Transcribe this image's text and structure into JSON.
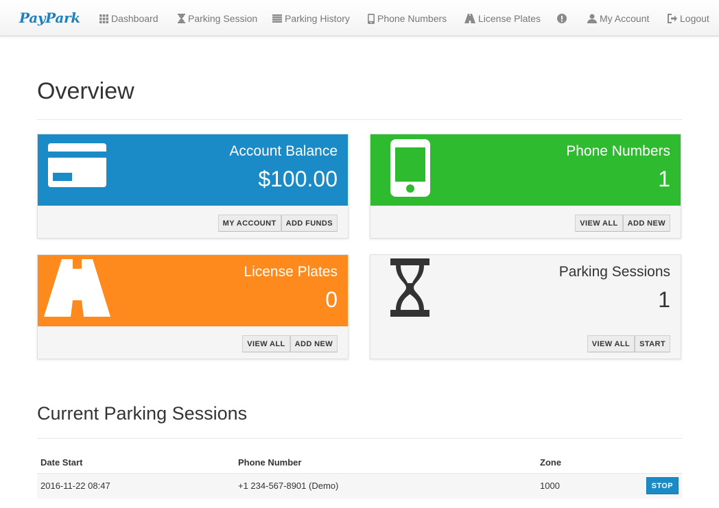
{
  "nav": {
    "brand": "PayPark",
    "items": [
      {
        "label": "Dashboard",
        "icon": "grid-icon"
      },
      {
        "label": "Parking Session",
        "icon": "hourglass-icon"
      },
      {
        "label": "Parking History",
        "icon": "list-icon"
      },
      {
        "label": "Phone Numbers",
        "icon": "phone-icon"
      },
      {
        "label": "License Plates",
        "icon": "road-icon"
      },
      {
        "label": "",
        "icon": "alert-icon"
      },
      {
        "label": "My Account",
        "icon": "user-icon"
      },
      {
        "label": "Logout",
        "icon": "logout-icon"
      }
    ]
  },
  "overview": {
    "title": "Overview",
    "cards": [
      {
        "title": "Account Balance",
        "value": "$100.00",
        "icon": "credit-card-icon",
        "color": "#1a8bc7",
        "buttons": [
          "MY ACCOUNT",
          "ADD FUNDS"
        ]
      },
      {
        "title": "Phone Numbers",
        "value": "1",
        "icon": "phone-icon",
        "color": "#2fbb2f",
        "buttons": [
          "VIEW ALL",
          "ADD NEW"
        ]
      },
      {
        "title": "License Plates",
        "value": "0",
        "icon": "road-icon",
        "color": "#fe8a1d",
        "buttons": [
          "VIEW ALL",
          "ADD NEW"
        ]
      },
      {
        "title": "Parking Sessions",
        "value": "1",
        "icon": "hourglass-icon",
        "color": "#f5f5f5",
        "buttons": [
          "VIEW ALL",
          "START"
        ]
      }
    ]
  },
  "sessions": {
    "title": "Current Parking Sessions",
    "columns": [
      "Date Start",
      "Phone Number",
      "Zone",
      ""
    ],
    "rows": [
      {
        "date_start": "2016-11-22 08:47",
        "phone": "+1 234-567-8901 (Demo)",
        "zone": "1000",
        "action": "STOP"
      }
    ]
  }
}
